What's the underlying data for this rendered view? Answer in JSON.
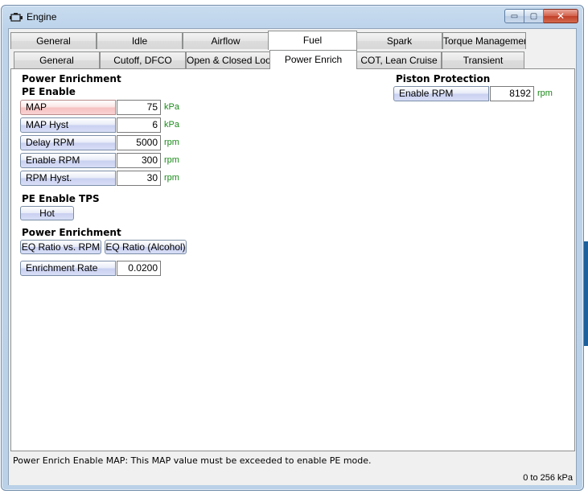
{
  "window": {
    "title": "Engine",
    "icon": "engine-icon"
  },
  "titlebar_buttons": {
    "minimize": "▭",
    "maximize": "▢",
    "close": "✕"
  },
  "tabs_main": [
    {
      "label": "General",
      "active": false
    },
    {
      "label": "Idle",
      "active": false
    },
    {
      "label": "Airflow",
      "active": false
    },
    {
      "label": "Fuel",
      "active": true
    },
    {
      "label": "Spark",
      "active": false
    },
    {
      "label": "Torque Management",
      "active": false
    }
  ],
  "tabs_fuel": [
    {
      "label": "General",
      "active": false
    },
    {
      "label": "Cutoff, DFCO",
      "active": false
    },
    {
      "label": "Open & Closed Loop",
      "active": false
    },
    {
      "label": "Power Enrich",
      "active": true
    },
    {
      "label": "COT, Lean Cruise",
      "active": false
    },
    {
      "label": "Transient",
      "active": false
    }
  ],
  "power_enrichment": {
    "title": "Power Enrichment",
    "pe_enable": {
      "title": "PE Enable",
      "fields": [
        {
          "label": "MAP",
          "value": "75",
          "unit": "kPa",
          "highlight": true
        },
        {
          "label": "MAP Hyst",
          "value": "6",
          "unit": "kPa",
          "highlight": false
        },
        {
          "label": "Delay RPM",
          "value": "5000",
          "unit": "rpm",
          "highlight": false
        },
        {
          "label": "Enable RPM",
          "value": "300",
          "unit": "rpm",
          "highlight": false
        },
        {
          "label": "RPM Hyst.",
          "value": "30",
          "unit": "rpm",
          "highlight": false
        }
      ]
    },
    "pe_enable_tps": {
      "title": "PE Enable TPS",
      "button": "Hot"
    },
    "power_enrichment_2": {
      "title": "Power Enrichment",
      "buttons": [
        "EQ Ratio vs. RPM",
        "EQ Ratio (Alcohol)"
      ],
      "enrichment_rate": {
        "label": "Enrichment Rate",
        "value": "0.0200"
      }
    }
  },
  "piston_protection": {
    "title": "Piston Protection",
    "field": {
      "label": "Enable RPM",
      "value": "8192",
      "unit": "rpm"
    }
  },
  "status": {
    "message": "Power Enrich Enable MAP: This MAP value must be exceeded to enable PE mode.",
    "range": "0 to 256 kPa"
  },
  "colors": {
    "unit_text": "#1a8a1a",
    "highlight_label": "#f6c0c0",
    "label_button": "#c9d0f0"
  }
}
